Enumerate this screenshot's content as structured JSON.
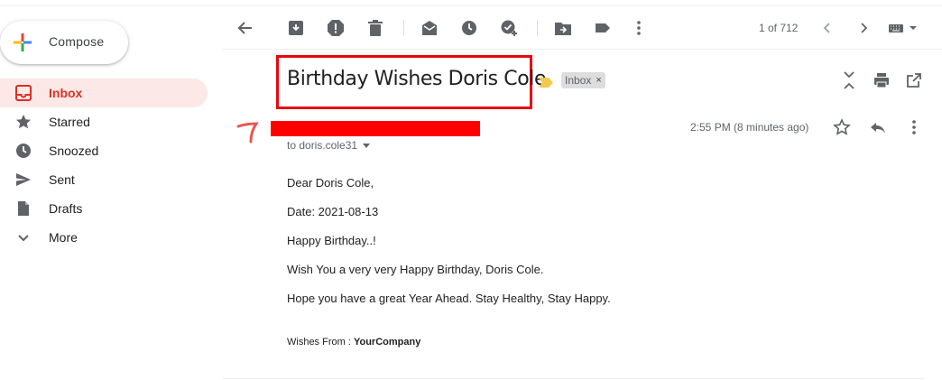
{
  "sidebar": {
    "compose_label": "Compose",
    "items": [
      {
        "label": "Inbox",
        "icon": "inbox-icon",
        "active": true
      },
      {
        "label": "Starred",
        "icon": "star-icon"
      },
      {
        "label": "Snoozed",
        "icon": "clock-icon"
      },
      {
        "label": "Sent",
        "icon": "send-icon"
      },
      {
        "label": "Drafts",
        "icon": "draft-icon"
      },
      {
        "label": "More",
        "icon": "chevron-down-icon"
      }
    ]
  },
  "toolbar": {
    "count": "1 of 712",
    "icons": [
      "back-arrow-icon",
      "archive-icon",
      "report-spam-icon",
      "delete-icon",
      "mark-unread-icon",
      "snooze-icon",
      "add-task-icon",
      "move-to-icon",
      "label-icon",
      "more-vert-icon",
      "newer-icon",
      "older-icon",
      "input-tools-icon"
    ]
  },
  "email": {
    "subject": "Birthday Wishes Doris Cole",
    "label_chip": "Inbox",
    "label_remove": "×",
    "to": "to doris.cole31",
    "time": "2:55 PM (8 minutes ago)",
    "body": [
      "Dear Doris Cole,",
      "Date: 2021-08-13",
      "Happy Birthday..!",
      "Wish You a very very Happy Birthday, Doris Cole.",
      "Hope you have a great Year Ahead. Stay Healthy, Stay Happy."
    ],
    "wishes_prefix": "Wishes From : ",
    "wishes_company": "YourCompany"
  },
  "colors": {
    "accent_red": "#d93025",
    "active_bg": "#fce8e6",
    "highlight_box": "#e8060e",
    "important_marker": "#f2c94c",
    "chip_bg": "#dddddd"
  }
}
